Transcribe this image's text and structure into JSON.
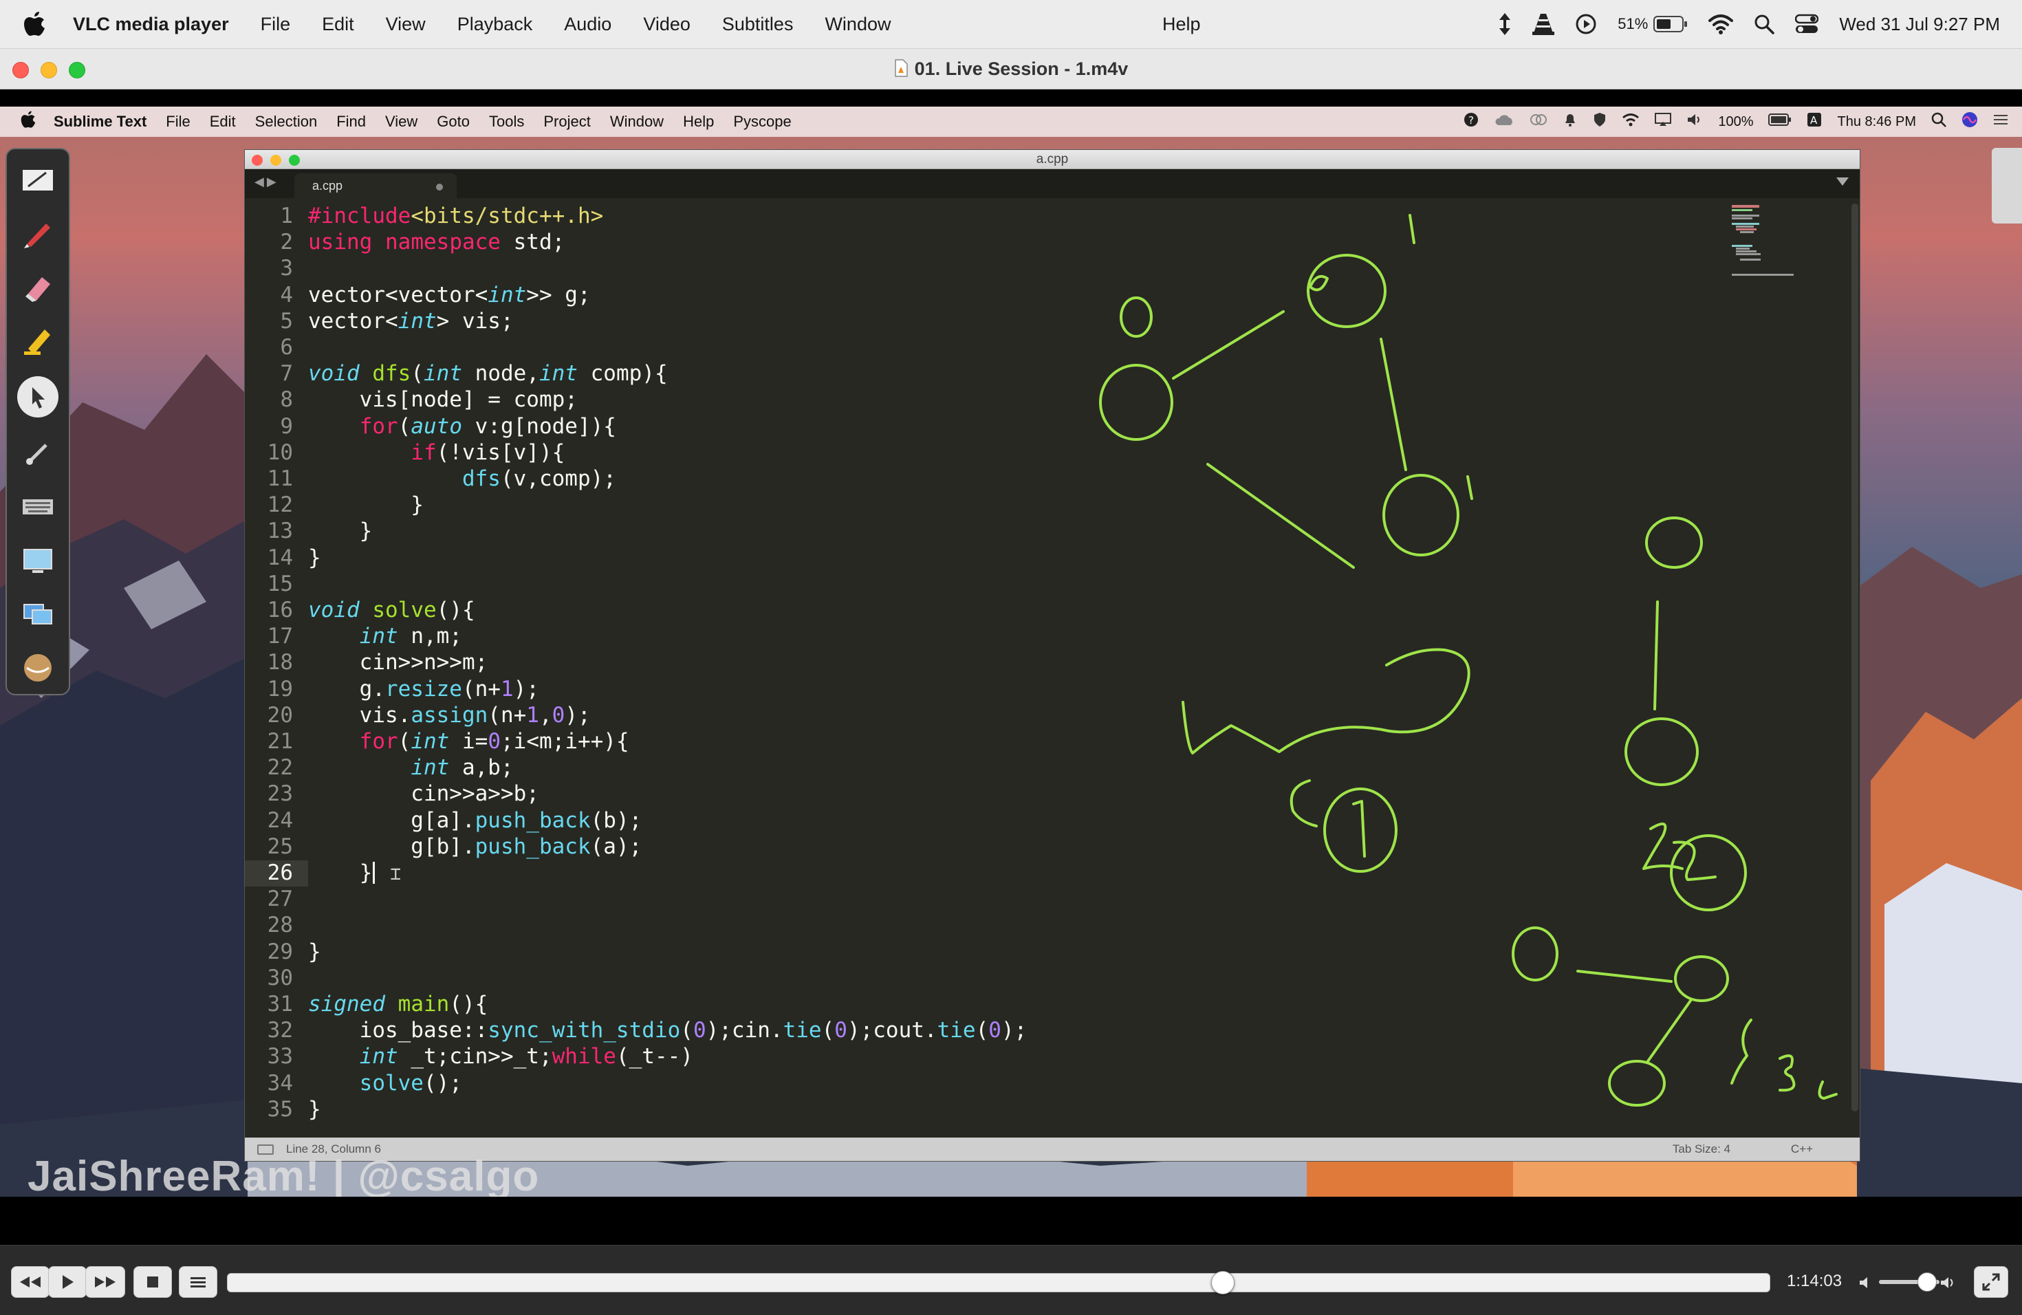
{
  "menubar": {
    "app_name": "VLC media player",
    "items": [
      "File",
      "Edit",
      "View",
      "Playback",
      "Audio",
      "Video",
      "Subtitles",
      "Window"
    ],
    "help": "Help",
    "battery": "51%",
    "clock": "Wed 31 Jul  9:27 PM"
  },
  "vlc_window": {
    "title": "01. Live Session - 1.m4v"
  },
  "inner_menubar": {
    "app_name": "Sublime Text",
    "items": [
      "File",
      "Edit",
      "Selection",
      "Find",
      "View",
      "Goto",
      "Tools",
      "Project",
      "Window",
      "Help",
      "Pyscope"
    ],
    "battery": "100%",
    "clock": "Thu 8:46 PM"
  },
  "sublime": {
    "window_title": "a.cpp",
    "tab_label": "a.cpp",
    "status_position": "Line 28, Column 6",
    "status_tab_size": "Tab Size: 4",
    "status_syntax": "C++",
    "current_line": 26,
    "code_lines": [
      [
        {
          "t": "#include",
          "c": "kw"
        },
        {
          "t": "<bits/stdc++.h>",
          "c": "st"
        }
      ],
      [
        {
          "t": "using",
          "c": "kw"
        },
        {
          "t": " "
        },
        {
          "t": "namespace",
          "c": "kw"
        },
        {
          "t": " std;"
        }
      ],
      [],
      [
        {
          "t": "vector<vector<"
        },
        {
          "t": "int",
          "c": "ty"
        },
        {
          "t": ">> g;"
        }
      ],
      [
        {
          "t": "vector<"
        },
        {
          "t": "int",
          "c": "ty"
        },
        {
          "t": "> vis;"
        }
      ],
      [],
      [
        {
          "t": "void",
          "c": "ty"
        },
        {
          "t": " "
        },
        {
          "t": "dfs",
          "c": "fn"
        },
        {
          "t": "("
        },
        {
          "t": "int",
          "c": "ty"
        },
        {
          "t": " node,"
        },
        {
          "t": "int",
          "c": "ty"
        },
        {
          "t": " comp){"
        }
      ],
      [
        {
          "t": "    vis[node] = comp;"
        }
      ],
      [
        {
          "t": "    "
        },
        {
          "t": "for",
          "c": "kw"
        },
        {
          "t": "("
        },
        {
          "t": "auto",
          "c": "ty"
        },
        {
          "t": " v:g[node]){"
        }
      ],
      [
        {
          "t": "        "
        },
        {
          "t": "if",
          "c": "kw"
        },
        {
          "t": "(!vis[v]){"
        }
      ],
      [
        {
          "t": "            "
        },
        {
          "t": "dfs",
          "c": "ac"
        },
        {
          "t": "(v,comp);"
        }
      ],
      [
        {
          "t": "        }"
        }
      ],
      [
        {
          "t": "    }"
        }
      ],
      [
        {
          "t": "}"
        }
      ],
      [],
      [
        {
          "t": "void",
          "c": "ty"
        },
        {
          "t": " "
        },
        {
          "t": "solve",
          "c": "fn"
        },
        {
          "t": "(){"
        }
      ],
      [
        {
          "t": "    "
        },
        {
          "t": "int",
          "c": "ty"
        },
        {
          "t": " n,m;"
        }
      ],
      [
        {
          "t": "    cin>>n>>m;"
        }
      ],
      [
        {
          "t": "    g."
        },
        {
          "t": "resize",
          "c": "ac"
        },
        {
          "t": "(n+"
        },
        {
          "t": "1",
          "c": "nu"
        },
        {
          "t": ");"
        }
      ],
      [
        {
          "t": "    vis."
        },
        {
          "t": "assign",
          "c": "ac"
        },
        {
          "t": "(n+"
        },
        {
          "t": "1",
          "c": "nu"
        },
        {
          "t": ","
        },
        {
          "t": "0",
          "c": "nu"
        },
        {
          "t": ");"
        }
      ],
      [
        {
          "t": "    "
        },
        {
          "t": "for",
          "c": "kw"
        },
        {
          "t": "("
        },
        {
          "t": "int",
          "c": "ty"
        },
        {
          "t": " i="
        },
        {
          "t": "0",
          "c": "nu"
        },
        {
          "t": ";i<m;i++){"
        }
      ],
      [
        {
          "t": "        "
        },
        {
          "t": "int",
          "c": "ty"
        },
        {
          "t": " a,b;"
        }
      ],
      [
        {
          "t": "        cin>>a>>b;"
        }
      ],
      [
        {
          "t": "        g[a]."
        },
        {
          "t": "push_back",
          "c": "ac"
        },
        {
          "t": "(b);"
        }
      ],
      [
        {
          "t": "        g[b]."
        },
        {
          "t": "push_back",
          "c": "ac"
        },
        {
          "t": "(a);"
        }
      ],
      [
        {
          "t": "    }"
        }
      ],
      [],
      [],
      [
        {
          "t": "}"
        }
      ],
      [],
      [
        {
          "t": "signed",
          "c": "ty"
        },
        {
          "t": " "
        },
        {
          "t": "main",
          "c": "fn"
        },
        {
          "t": "(){"
        }
      ],
      [
        {
          "t": "    ios_base::"
        },
        {
          "t": "sync_with_stdio",
          "c": "ac"
        },
        {
          "t": "("
        },
        {
          "t": "0",
          "c": "nu"
        },
        {
          "t": ");cin."
        },
        {
          "t": "tie",
          "c": "ac"
        },
        {
          "t": "("
        },
        {
          "t": "0",
          "c": "nu"
        },
        {
          "t": ");cout."
        },
        {
          "t": "tie",
          "c": "ac"
        },
        {
          "t": "("
        },
        {
          "t": "0",
          "c": "nu"
        },
        {
          "t": ");"
        }
      ],
      [
        {
          "t": "    "
        },
        {
          "t": "int",
          "c": "ty"
        },
        {
          "t": " _t;cin>>_t;"
        },
        {
          "t": "while",
          "c": "kw"
        },
        {
          "t": "(_t--)"
        }
      ],
      [
        {
          "t": "    "
        },
        {
          "t": "solve",
          "c": "ac"
        },
        {
          "t": "();"
        }
      ],
      [
        {
          "t": "}"
        }
      ]
    ]
  },
  "watermark": "JaiShreeRam! | @csalgo",
  "player": {
    "timecode": "1:14:03",
    "progress": 0.645,
    "volume": 0.8
  },
  "colors": {
    "annotation_ink": "#9fe44a",
    "editor_bg": "#272822"
  }
}
